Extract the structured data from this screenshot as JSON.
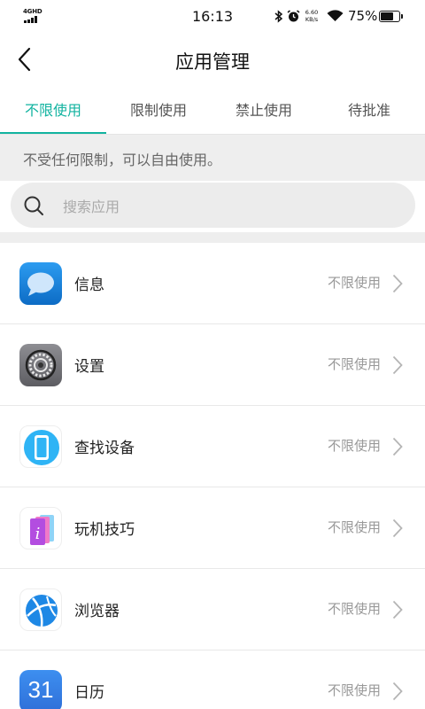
{
  "status_bar": {
    "network": "4GHD",
    "time": "16:13",
    "speed_value": "6.60",
    "speed_unit": "KB/s",
    "battery": "75%",
    "battery_level": 0.75
  },
  "header": {
    "title": "应用管理"
  },
  "tabs": [
    {
      "label": "不限使用",
      "active": true
    },
    {
      "label": "限制使用",
      "active": false
    },
    {
      "label": "禁止使用",
      "active": false
    },
    {
      "label": "待批准",
      "active": false
    }
  ],
  "info": {
    "text": "不受任何限制，可以自由使用。"
  },
  "search": {
    "placeholder": "搜索应用"
  },
  "apps": [
    {
      "name": "信息",
      "status": "不限使用",
      "icon": "messages-icon"
    },
    {
      "name": "设置",
      "status": "不限使用",
      "icon": "settings-icon"
    },
    {
      "name": "查找设备",
      "status": "不限使用",
      "icon": "find-device-icon"
    },
    {
      "name": "玩机技巧",
      "status": "不限使用",
      "icon": "tips-icon"
    },
    {
      "name": "浏览器",
      "status": "不限使用",
      "icon": "browser-icon"
    },
    {
      "name": "日历",
      "status": "不限使用",
      "icon": "calendar-icon",
      "icon_text": "31"
    }
  ],
  "colors": {
    "accent": "#12b3a0",
    "banner_bg": "#eeeeee"
  }
}
